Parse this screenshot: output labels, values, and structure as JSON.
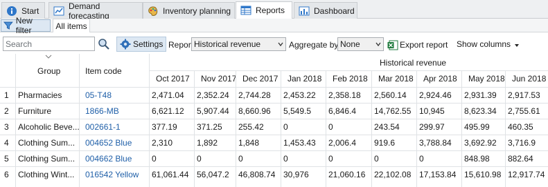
{
  "tabs": [
    {
      "label": "Start",
      "icon": "info-icon"
    },
    {
      "label": "Demand forecasting",
      "icon": "line-chart-icon"
    },
    {
      "label": "Inventory planning",
      "icon": "palette-icon"
    },
    {
      "label": "Reports",
      "icon": "report-table-icon",
      "active": true
    },
    {
      "label": "Dashboard",
      "icon": "bar-chart-icon"
    }
  ],
  "filters": {
    "new_filter": "New filter",
    "all_items": "All items"
  },
  "toolbar": {
    "search_placeholder": "Search",
    "settings": "Settings",
    "report_label": "Report",
    "report_value": "Historical revenue",
    "aggregate_label": "Aggregate by",
    "aggregate_value": "None",
    "export": "Export report",
    "show_columns": "Show columns"
  },
  "table": {
    "group_header": "Group",
    "item_header": "Item code",
    "super_header": "Historical revenue",
    "months": [
      "Oct 2017",
      "Nov 2017",
      "Dec 2017",
      "Jan 2018",
      "Feb 2018",
      "Mar 2018",
      "Apr 2018",
      "May 2018",
      "Jun 2018"
    ],
    "rows": [
      {
        "n": "1",
        "group": "Pharmacies",
        "item": "05-T48",
        "values": [
          "2,471.04",
          "2,352.24",
          "2,744.28",
          "2,453.22",
          "2,358.18",
          "2,560.14",
          "2,924.46",
          "2,931.39",
          "2,917.53"
        ]
      },
      {
        "n": "2",
        "group": "Furniture",
        "item": "1866-MB",
        "values": [
          "6,621.12",
          "5,907.44",
          "8,660.96",
          "5,549.5",
          "6,846.4",
          "14,762.55",
          "10,945",
          "8,623.34",
          "2,755.61"
        ]
      },
      {
        "n": "3",
        "group": "Alcoholic Beve...",
        "item": "002661-1",
        "values": [
          "377.19",
          "371.25",
          "255.42",
          "0",
          "0",
          "243.54",
          "299.97",
          "495.99",
          "460.35"
        ]
      },
      {
        "n": "4",
        "group": "Clothing Sum...",
        "item": "004652 Blue",
        "values": [
          "2,310",
          "1,892",
          "1,848",
          "1,453.43",
          "2,006.4",
          "919.6",
          "3,788.84",
          "3,692.92",
          "3,716.9"
        ]
      },
      {
        "n": "5",
        "group": "Clothing Sum...",
        "item": "004662 Blue",
        "values": [
          "0",
          "0",
          "0",
          "0",
          "0",
          "0",
          "0",
          "848.98",
          "882.64"
        ]
      },
      {
        "n": "6",
        "group": "Clothing Wint...",
        "item": "016542 Yellow",
        "values": [
          "61,061.44",
          "56,047.2",
          "46,808.74",
          "30,976",
          "21,060.16",
          "22,102.08",
          "17,153.84",
          "15,610.98",
          "12,917.74"
        ]
      }
    ]
  }
}
